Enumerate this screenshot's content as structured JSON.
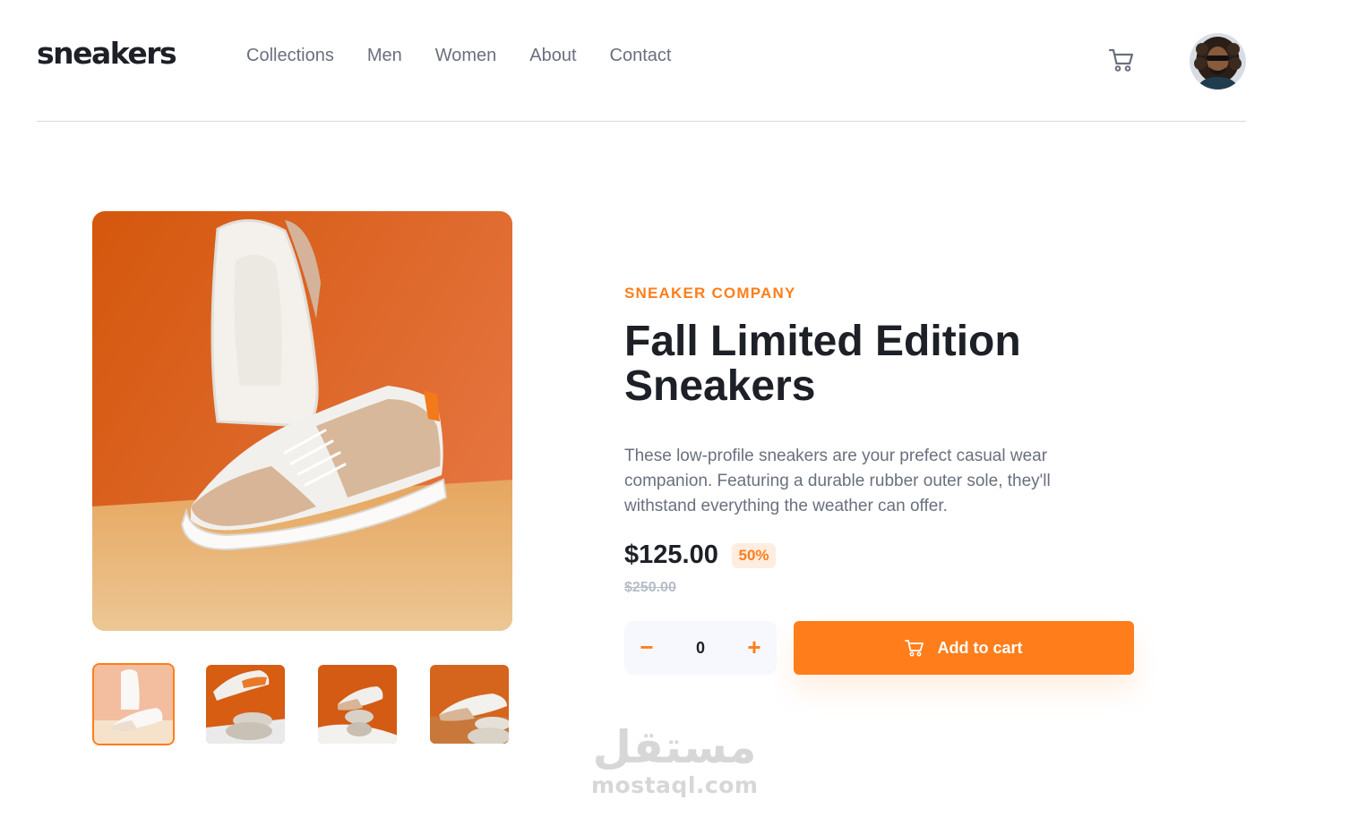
{
  "header": {
    "logo": "sneakers",
    "nav": [
      "Collections",
      "Men",
      "Women",
      "About",
      "Contact"
    ]
  },
  "icons": {
    "cart": "cart-icon",
    "minus": "minus-icon",
    "plus": "plus-icon",
    "avatar": "user-avatar"
  },
  "colors": {
    "accent": "#ff7e1b",
    "accent_pale": "#ffede0",
    "dark": "#1d2026",
    "gray": "#69707d",
    "light_gray": "#b6bcc8"
  },
  "gallery": {
    "thumbnails": 4,
    "active_thumbnail": 1
  },
  "product": {
    "company": "SNEAKER COMPANY",
    "title_line1": "Fall Limited Edition",
    "title_line2": "Sneakers",
    "description": "These low-profile sneakers are your prefect casual wear companion. Featuring a durable rubber outer sole, they'll withstand everything the weather can offer.",
    "price": "$125.00",
    "discount": "50%",
    "old_price": "$250.00"
  },
  "cart": {
    "quantity": "0",
    "minus_label": "−",
    "plus_label": "+",
    "add_label": "Add to cart"
  },
  "watermark": {
    "arabic": "مستقل",
    "latin": "mostaql.com"
  }
}
